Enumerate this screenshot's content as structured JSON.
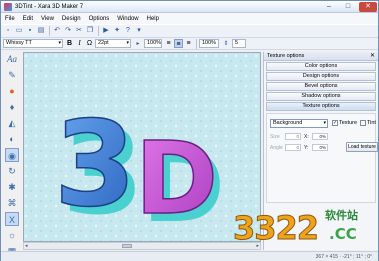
{
  "window": {
    "title": "3DTint - Xara 3D Maker 7",
    "min": "–",
    "max": "□",
    "close": "✕"
  },
  "menu": [
    "File",
    "Edit",
    "View",
    "Design",
    "Options",
    "Window",
    "Help"
  ],
  "toolbar2": {
    "font": "Whissy TT",
    "size": "22pt",
    "zoom": "100%",
    "spacing": "100%",
    "extra": "5"
  },
  "canvas": {
    "text": "3D",
    "colors": {
      "background": "#c7e8ee",
      "three": "#3b7fd9",
      "d": "#cc4fd6",
      "extrude": "#5ad3d6"
    }
  },
  "panel": {
    "title": "Texture options",
    "options": [
      "Color options",
      "Design options",
      "Bevel options",
      "Shadow options",
      "Texture options"
    ],
    "texture": {
      "target": "Background",
      "texture_label": "Texture",
      "tint_label": "Tint",
      "size_label": "Size",
      "angle_label": "Angle",
      "x_label": "X:",
      "y_label": "Y:",
      "size_value": "0",
      "angle_value": "0",
      "x_value": "0%",
      "y_value": "0%",
      "load_button": "Load texture"
    }
  },
  "status": {
    "text": "367 × 415 · -21° ; 11° ; 0°"
  },
  "watermark": {
    "big": "3322",
    "cn": "软件站",
    "cc": ".CC"
  }
}
